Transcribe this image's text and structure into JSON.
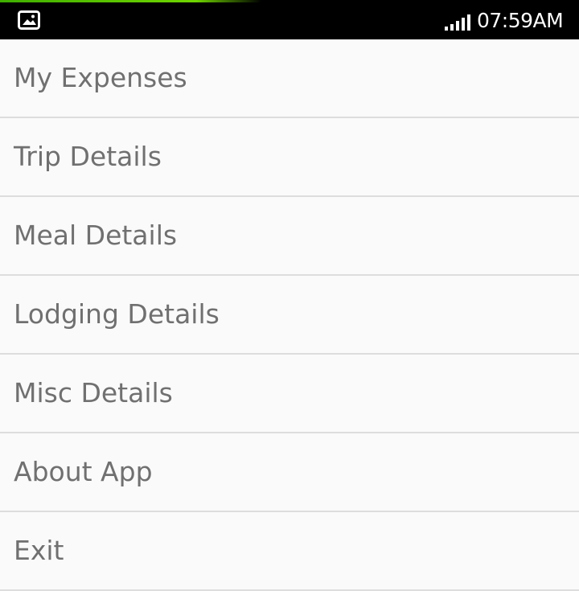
{
  "status_bar": {
    "notification_icon": "gallery-icon",
    "signal_icon": "signal-bars-icon",
    "time": "07:59AM"
  },
  "menu": {
    "items": [
      {
        "label": "My Expenses"
      },
      {
        "label": "Trip Details"
      },
      {
        "label": "Meal Details"
      },
      {
        "label": "Lodging Details"
      },
      {
        "label": "Misc Details"
      },
      {
        "label": "About App"
      },
      {
        "label": "Exit"
      }
    ]
  },
  "colors": {
    "status_bar_bg": "#000000",
    "menu_bg": "#fafafa",
    "label_text": "#707070",
    "divider": "#dddddd",
    "progress_accent": "#6fd400"
  }
}
